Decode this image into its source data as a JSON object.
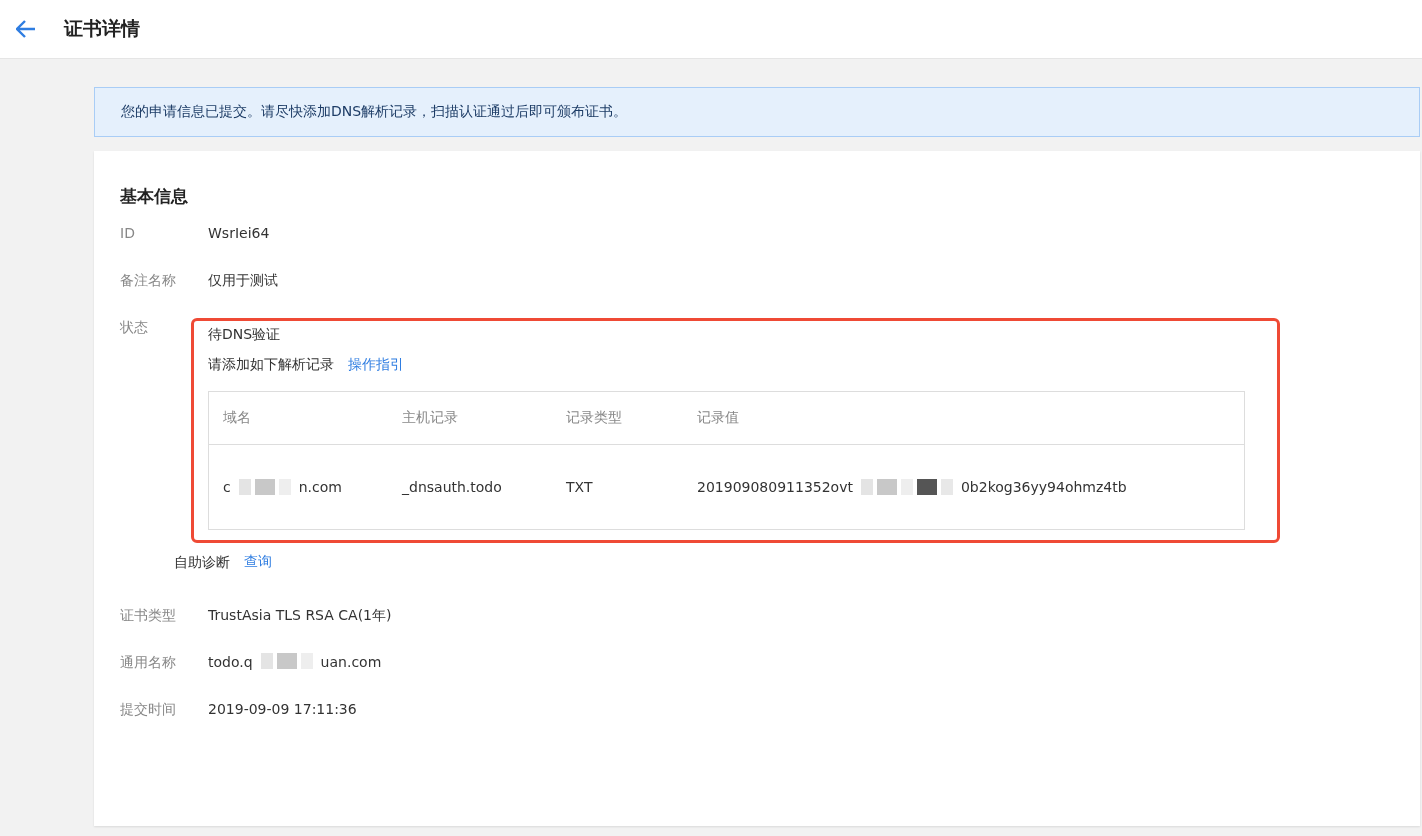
{
  "header": {
    "title": "证书详情"
  },
  "notice": "您的申请信息已提交。请尽快添加DNS解析记录，扫描认证通过后即可颁布证书。",
  "section_title": "基本信息",
  "fields": [
    {
      "kind": "text",
      "label": "ID",
      "value": "WsrIei64"
    },
    {
      "kind": "text",
      "label": "备注名称",
      "value": "仅用于测试"
    },
    {
      "kind": "status",
      "label": "状态",
      "status": "待DNS验证",
      "hint": "请添加如下解析记录",
      "hint_link": "操作指引",
      "table": {
        "columns": [
          "域名",
          "主机记录",
          "记录类型",
          "记录值"
        ],
        "rows": [
          {
            "domain": {
              "before": "c",
              "after": "n.com"
            },
            "host": "_dnsauth.todo",
            "type": "TXT",
            "value": {
              "before": "201909080911352ovt",
              "after": "0b2kog36yy94ohmz4tb"
            }
          }
        ]
      },
      "diagnose": "自助诊断",
      "diagnose_link": "查询"
    },
    {
      "kind": "text",
      "label": "证书类型",
      "value": "TrustAsia TLS RSA CA(1年)"
    },
    {
      "kind": "redacted",
      "label": "通用名称",
      "before": "todo.q",
      "after": "uan.com"
    },
    {
      "kind": "text",
      "label": "提交时间",
      "value": "2019-09-09 17:11:36"
    }
  ]
}
